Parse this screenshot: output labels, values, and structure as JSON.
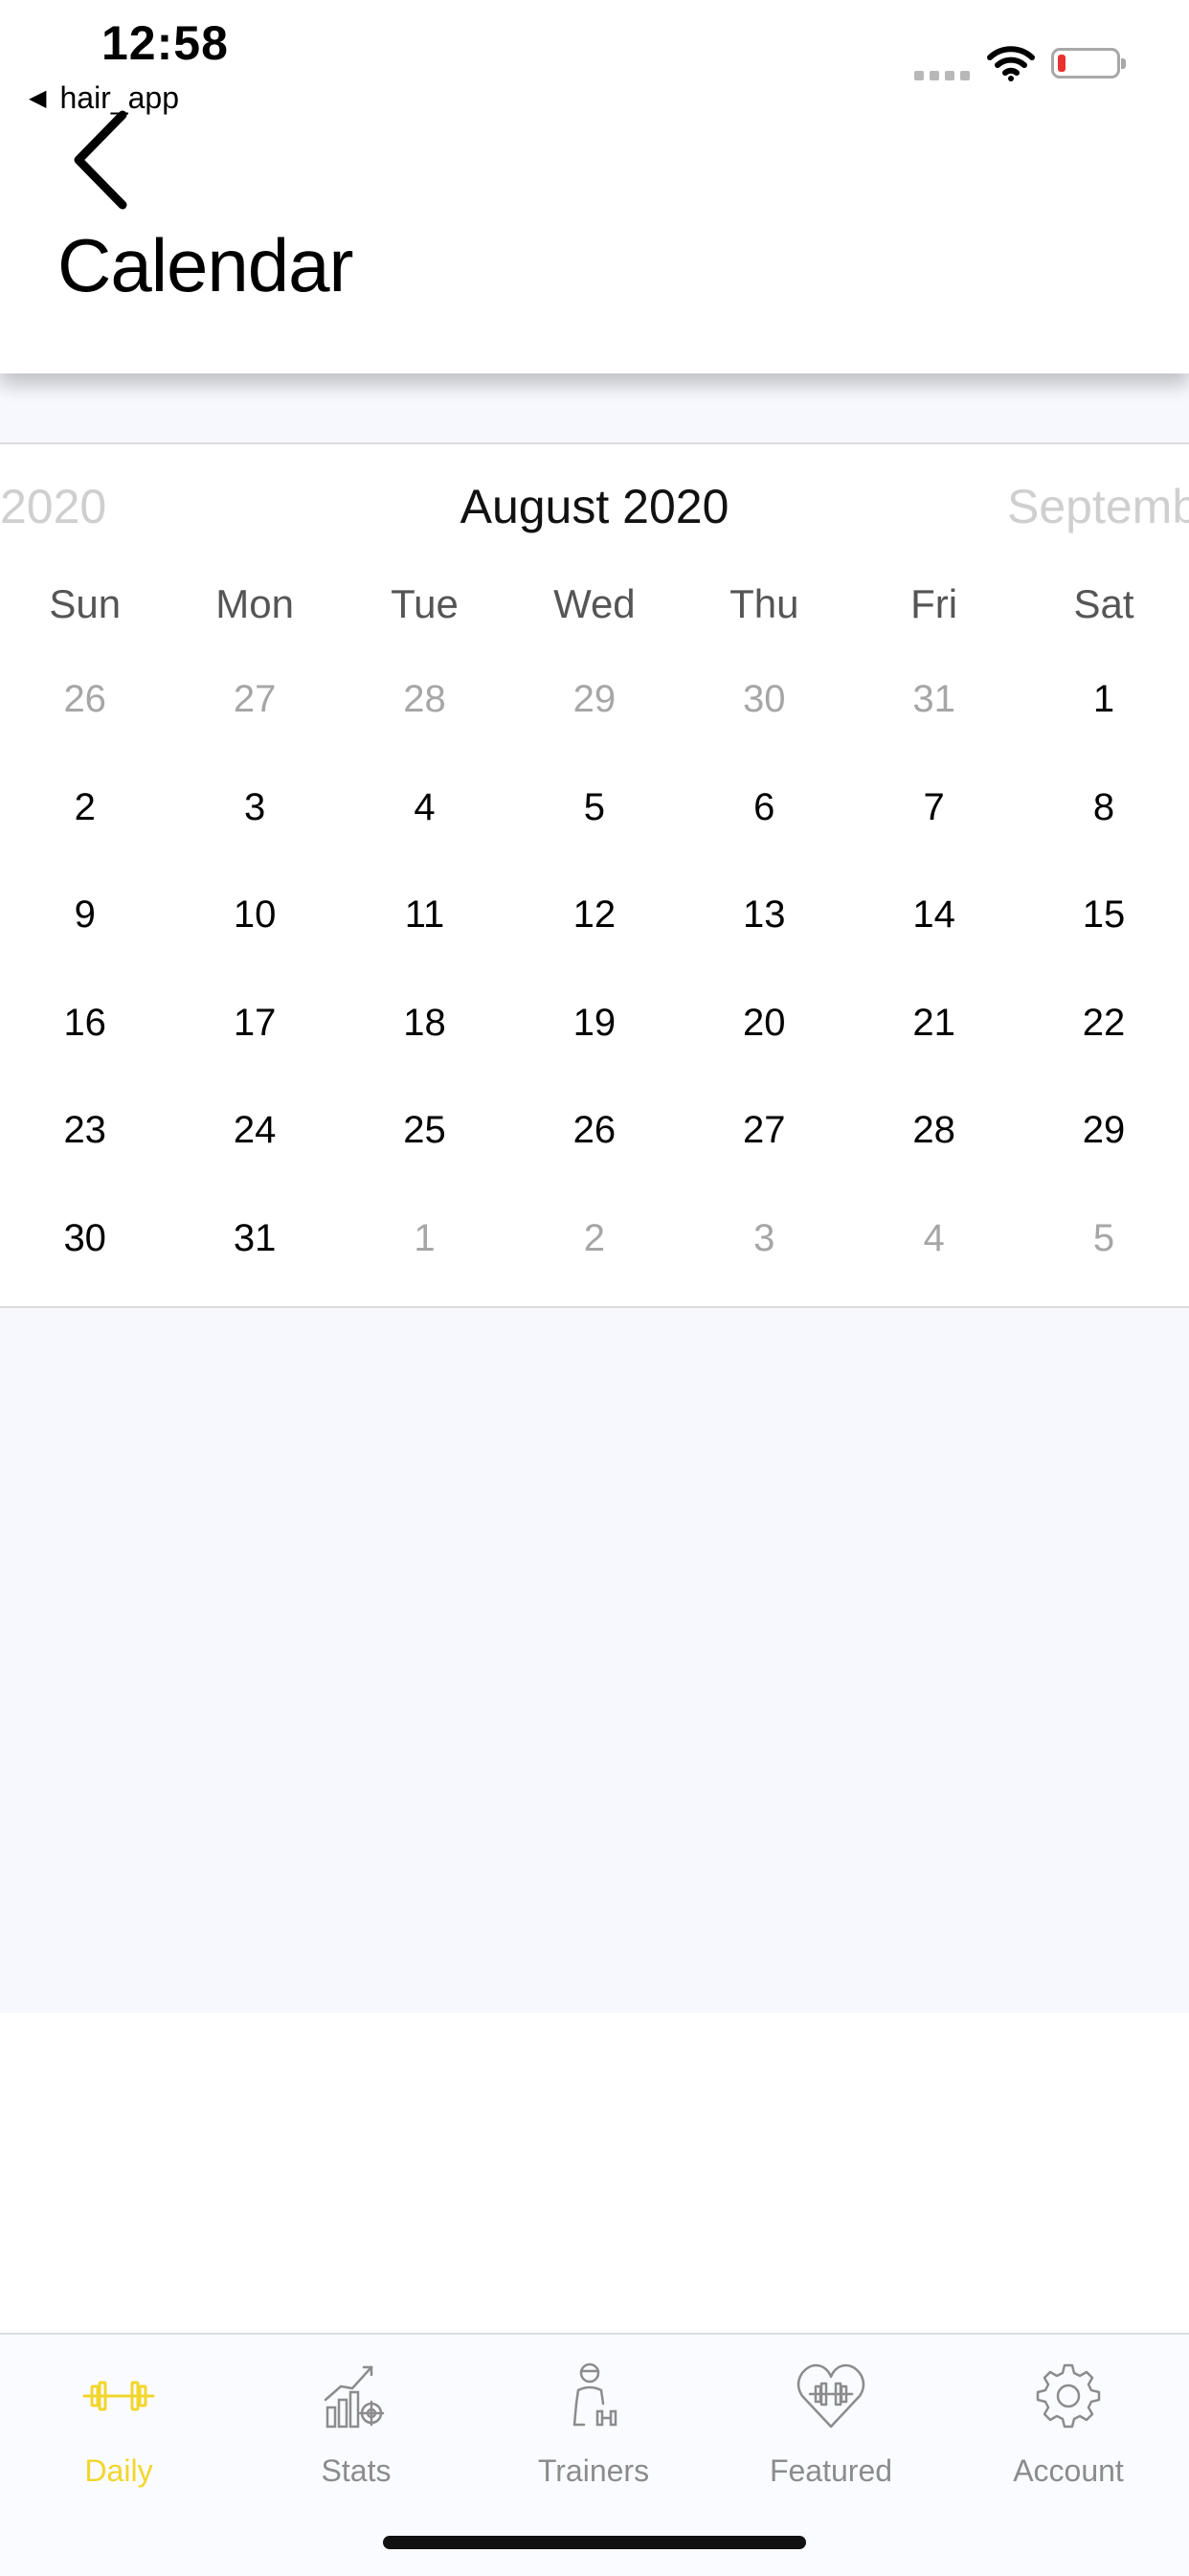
{
  "status_bar": {
    "time": "12:58",
    "back_app_label": "hair_app",
    "battery_color": "#e8322f"
  },
  "header": {
    "title": "Calendar",
    "back_icon": "chevron-left-icon"
  },
  "calendar": {
    "prev_month": "2020",
    "current_month": "August 2020",
    "next_month": "Septemb",
    "weekdays": [
      "Sun",
      "Mon",
      "Tue",
      "Wed",
      "Thu",
      "Fri",
      "Sat"
    ],
    "weeks": [
      [
        {
          "d": "26",
          "muted": true
        },
        {
          "d": "27",
          "muted": true
        },
        {
          "d": "28",
          "muted": true
        },
        {
          "d": "29",
          "muted": true
        },
        {
          "d": "30",
          "muted": true
        },
        {
          "d": "31",
          "muted": true
        },
        {
          "d": "1",
          "muted": false
        }
      ],
      [
        {
          "d": "2",
          "muted": false
        },
        {
          "d": "3",
          "muted": false
        },
        {
          "d": "4",
          "muted": false
        },
        {
          "d": "5",
          "muted": false
        },
        {
          "d": "6",
          "muted": false
        },
        {
          "d": "7",
          "muted": false
        },
        {
          "d": "8",
          "muted": false
        }
      ],
      [
        {
          "d": "9",
          "muted": false
        },
        {
          "d": "10",
          "muted": false
        },
        {
          "d": "11",
          "muted": false
        },
        {
          "d": "12",
          "muted": false
        },
        {
          "d": "13",
          "muted": false
        },
        {
          "d": "14",
          "muted": false
        },
        {
          "d": "15",
          "muted": false
        }
      ],
      [
        {
          "d": "16",
          "muted": false
        },
        {
          "d": "17",
          "muted": false
        },
        {
          "d": "18",
          "muted": false
        },
        {
          "d": "19",
          "muted": false
        },
        {
          "d": "20",
          "muted": false
        },
        {
          "d": "21",
          "muted": false
        },
        {
          "d": "22",
          "muted": false
        }
      ],
      [
        {
          "d": "23",
          "muted": false
        },
        {
          "d": "24",
          "muted": false
        },
        {
          "d": "25",
          "muted": false
        },
        {
          "d": "26",
          "muted": false
        },
        {
          "d": "27",
          "muted": false
        },
        {
          "d": "28",
          "muted": false
        },
        {
          "d": "29",
          "muted": false
        }
      ],
      [
        {
          "d": "30",
          "muted": false
        },
        {
          "d": "31",
          "muted": false
        },
        {
          "d": "1",
          "muted": true
        },
        {
          "d": "2",
          "muted": true
        },
        {
          "d": "3",
          "muted": true
        },
        {
          "d": "4",
          "muted": true
        },
        {
          "d": "5",
          "muted": true
        }
      ]
    ]
  },
  "tabbar": {
    "active_color": "#f1d62c",
    "inactive_color": "#8c8c8c",
    "tabs": [
      {
        "label": "Daily",
        "icon": "dumbbell-icon",
        "active": true
      },
      {
        "label": "Stats",
        "icon": "chart-target-icon",
        "active": false
      },
      {
        "label": "Trainers",
        "icon": "trainer-icon",
        "active": false
      },
      {
        "label": "Featured",
        "icon": "heart-dumbbell-icon",
        "active": false
      },
      {
        "label": "Account",
        "icon": "gear-icon",
        "active": false
      }
    ]
  }
}
